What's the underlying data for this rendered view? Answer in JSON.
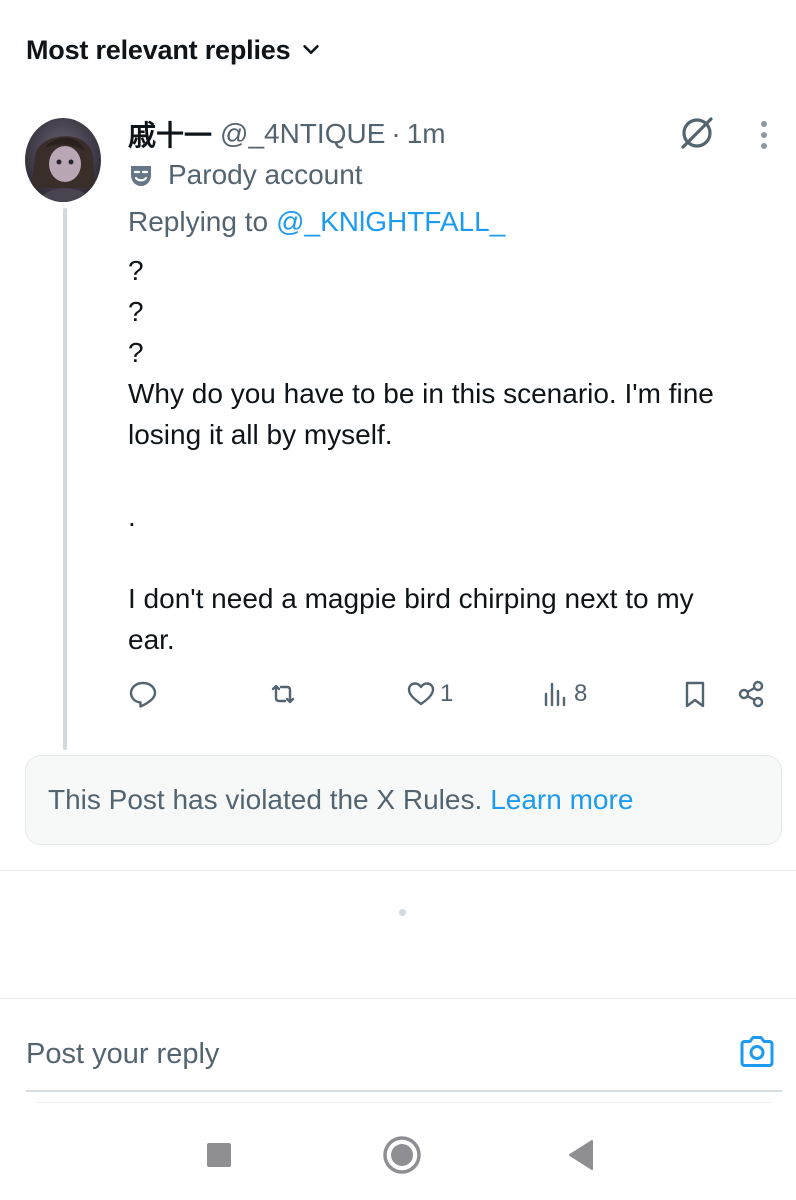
{
  "header": {
    "sort_label": "Most relevant replies",
    "sort_icon": "chevron-down-icon"
  },
  "post": {
    "display_name": "戚十一",
    "handle": "@_4NTIQUE",
    "separator": "·",
    "time": "1m",
    "parody_label": "Parody account",
    "replying_prefix": "Replying to",
    "replying_to": "@_KNlGHTFALL_",
    "text_lines": [
      "?",
      "?",
      "?",
      "Why do you have to be in this scenario. I'm fine",
      "losing it all by myself."
    ],
    "text_dot": ".",
    "text_lines_2": [
      "I don't need a magpie bird chirping next to my",
      "ear."
    ],
    "likes": "1",
    "views": "8"
  },
  "notice": {
    "text": "This Post has violated the X Rules.",
    "link": "Learn more"
  },
  "reply_box": {
    "placeholder": "Post your reply"
  },
  "colors": {
    "accent": "#1d9bf0",
    "text": "#0f1419",
    "secondary": "#536471",
    "notice_bg": "#f7f9f9"
  }
}
